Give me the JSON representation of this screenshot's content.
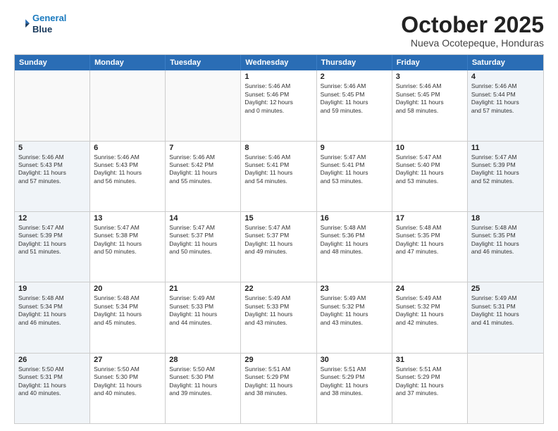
{
  "header": {
    "logo_line1": "General",
    "logo_line2": "Blue",
    "month": "October 2025",
    "location": "Nueva Ocotepeque, Honduras"
  },
  "weekdays": [
    "Sunday",
    "Monday",
    "Tuesday",
    "Wednesday",
    "Thursday",
    "Friday",
    "Saturday"
  ],
  "rows": [
    [
      {
        "day": "",
        "text": ""
      },
      {
        "day": "",
        "text": ""
      },
      {
        "day": "",
        "text": ""
      },
      {
        "day": "1",
        "text": "Sunrise: 5:46 AM\nSunset: 5:46 PM\nDaylight: 12 hours\nand 0 minutes."
      },
      {
        "day": "2",
        "text": "Sunrise: 5:46 AM\nSunset: 5:45 PM\nDaylight: 11 hours\nand 59 minutes."
      },
      {
        "day": "3",
        "text": "Sunrise: 5:46 AM\nSunset: 5:45 PM\nDaylight: 11 hours\nand 58 minutes."
      },
      {
        "day": "4",
        "text": "Sunrise: 5:46 AM\nSunset: 5:44 PM\nDaylight: 11 hours\nand 57 minutes."
      }
    ],
    [
      {
        "day": "5",
        "text": "Sunrise: 5:46 AM\nSunset: 5:43 PM\nDaylight: 11 hours\nand 57 minutes."
      },
      {
        "day": "6",
        "text": "Sunrise: 5:46 AM\nSunset: 5:43 PM\nDaylight: 11 hours\nand 56 minutes."
      },
      {
        "day": "7",
        "text": "Sunrise: 5:46 AM\nSunset: 5:42 PM\nDaylight: 11 hours\nand 55 minutes."
      },
      {
        "day": "8",
        "text": "Sunrise: 5:46 AM\nSunset: 5:41 PM\nDaylight: 11 hours\nand 54 minutes."
      },
      {
        "day": "9",
        "text": "Sunrise: 5:47 AM\nSunset: 5:41 PM\nDaylight: 11 hours\nand 53 minutes."
      },
      {
        "day": "10",
        "text": "Sunrise: 5:47 AM\nSunset: 5:40 PM\nDaylight: 11 hours\nand 53 minutes."
      },
      {
        "day": "11",
        "text": "Sunrise: 5:47 AM\nSunset: 5:39 PM\nDaylight: 11 hours\nand 52 minutes."
      }
    ],
    [
      {
        "day": "12",
        "text": "Sunrise: 5:47 AM\nSunset: 5:39 PM\nDaylight: 11 hours\nand 51 minutes."
      },
      {
        "day": "13",
        "text": "Sunrise: 5:47 AM\nSunset: 5:38 PM\nDaylight: 11 hours\nand 50 minutes."
      },
      {
        "day": "14",
        "text": "Sunrise: 5:47 AM\nSunset: 5:37 PM\nDaylight: 11 hours\nand 50 minutes."
      },
      {
        "day": "15",
        "text": "Sunrise: 5:47 AM\nSunset: 5:37 PM\nDaylight: 11 hours\nand 49 minutes."
      },
      {
        "day": "16",
        "text": "Sunrise: 5:48 AM\nSunset: 5:36 PM\nDaylight: 11 hours\nand 48 minutes."
      },
      {
        "day": "17",
        "text": "Sunrise: 5:48 AM\nSunset: 5:35 PM\nDaylight: 11 hours\nand 47 minutes."
      },
      {
        "day": "18",
        "text": "Sunrise: 5:48 AM\nSunset: 5:35 PM\nDaylight: 11 hours\nand 46 minutes."
      }
    ],
    [
      {
        "day": "19",
        "text": "Sunrise: 5:48 AM\nSunset: 5:34 PM\nDaylight: 11 hours\nand 46 minutes."
      },
      {
        "day": "20",
        "text": "Sunrise: 5:48 AM\nSunset: 5:34 PM\nDaylight: 11 hours\nand 45 minutes."
      },
      {
        "day": "21",
        "text": "Sunrise: 5:49 AM\nSunset: 5:33 PM\nDaylight: 11 hours\nand 44 minutes."
      },
      {
        "day": "22",
        "text": "Sunrise: 5:49 AM\nSunset: 5:33 PM\nDaylight: 11 hours\nand 43 minutes."
      },
      {
        "day": "23",
        "text": "Sunrise: 5:49 AM\nSunset: 5:32 PM\nDaylight: 11 hours\nand 43 minutes."
      },
      {
        "day": "24",
        "text": "Sunrise: 5:49 AM\nSunset: 5:32 PM\nDaylight: 11 hours\nand 42 minutes."
      },
      {
        "day": "25",
        "text": "Sunrise: 5:49 AM\nSunset: 5:31 PM\nDaylight: 11 hours\nand 41 minutes."
      }
    ],
    [
      {
        "day": "26",
        "text": "Sunrise: 5:50 AM\nSunset: 5:31 PM\nDaylight: 11 hours\nand 40 minutes."
      },
      {
        "day": "27",
        "text": "Sunrise: 5:50 AM\nSunset: 5:30 PM\nDaylight: 11 hours\nand 40 minutes."
      },
      {
        "day": "28",
        "text": "Sunrise: 5:50 AM\nSunset: 5:30 PM\nDaylight: 11 hours\nand 39 minutes."
      },
      {
        "day": "29",
        "text": "Sunrise: 5:51 AM\nSunset: 5:29 PM\nDaylight: 11 hours\nand 38 minutes."
      },
      {
        "day": "30",
        "text": "Sunrise: 5:51 AM\nSunset: 5:29 PM\nDaylight: 11 hours\nand 38 minutes."
      },
      {
        "day": "31",
        "text": "Sunrise: 5:51 AM\nSunset: 5:29 PM\nDaylight: 11 hours\nand 37 minutes."
      },
      {
        "day": "",
        "text": ""
      }
    ]
  ]
}
